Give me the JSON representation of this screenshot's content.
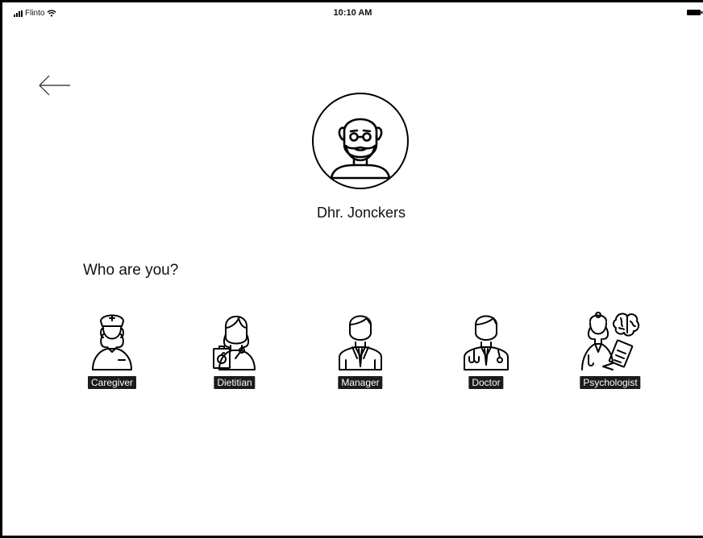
{
  "status_bar": {
    "carrier": "Flinto",
    "time": "10:10 AM",
    "signal_icon": "signal-bars-icon",
    "wifi_icon": "wifi-icon",
    "battery_icon": "battery-icon"
  },
  "navigation": {
    "back_icon": "back-arrow-icon"
  },
  "resident": {
    "avatar_icon": "elderly-man-icon",
    "name": "Dhr. Jonckers"
  },
  "prompt": "Who are you?",
  "roles": [
    {
      "label": "Caregiver",
      "icon": "nurse-icon"
    },
    {
      "label": "Dietitian",
      "icon": "dietitian-icon"
    },
    {
      "label": "Manager",
      "icon": "manager-icon"
    },
    {
      "label": "Doctor",
      "icon": "doctor-icon"
    },
    {
      "label": "Psychologist",
      "icon": "psychologist-icon"
    }
  ],
  "colors": {
    "label_background": "#1b1b1b",
    "label_text": "#ffffff",
    "stroke": "#000000",
    "background": "#ffffff"
  }
}
